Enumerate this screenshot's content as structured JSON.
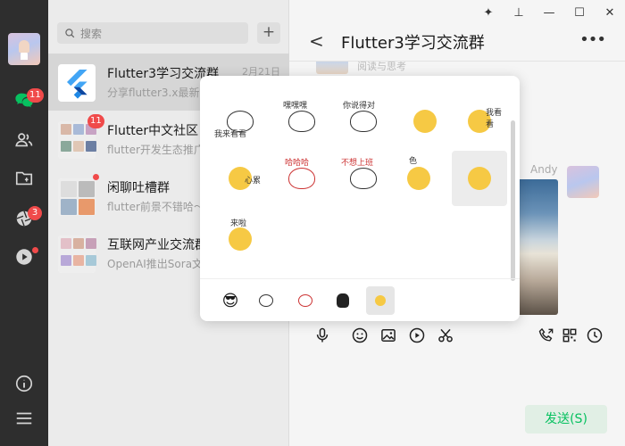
{
  "rail": {
    "chat_badge": "11",
    "moments_badge": "3"
  },
  "list": {
    "search_placeholder": "搜索",
    "add_label": "+",
    "chats": [
      {
        "name": "Flutter3学习交流群",
        "time": "2月21日",
        "preview": "分享flutter3.x最新"
      },
      {
        "name": "Flutter中文社区",
        "time": "",
        "preview": "flutter开发生态推广",
        "badge": "11"
      },
      {
        "name": "闲聊吐槽群",
        "time": "",
        "preview": "flutter前景不错哈～"
      },
      {
        "name": "互联网产业交流群",
        "time": "",
        "preview": "OpenAI推出Sora文"
      }
    ]
  },
  "pane": {
    "title": "Flutter3学习交流群",
    "top_message_fragment": "阅读与思考",
    "sender_name": "Andy",
    "send_label": "发送(S)"
  },
  "popup": {
    "stickers": [
      {
        "caption": "我来看看"
      },
      {
        "caption": "嘿嘿嘿"
      },
      {
        "caption": "你说得对"
      },
      {
        "caption": ""
      },
      {
        "caption": "我看看"
      },
      {
        "caption": "心累"
      },
      {
        "caption": "哈哈哈"
      },
      {
        "caption": "不想上班"
      },
      {
        "caption": "色"
      },
      {
        "caption": ""
      },
      {
        "caption": "来啦"
      }
    ],
    "tabs": [
      "sunglasses-emoji",
      "sticker-pack-1",
      "sticker-pack-2",
      "sticker-pack-3",
      "sticker-pack-4"
    ]
  },
  "colors": {
    "accent": "#07c160",
    "badge": "#f04a4a",
    "rail": "#2e2e2e"
  }
}
